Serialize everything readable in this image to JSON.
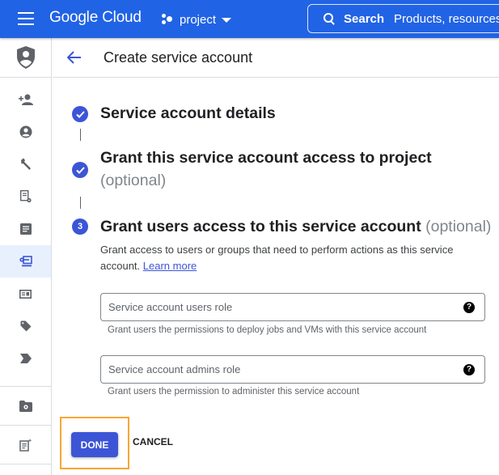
{
  "topbar": {
    "logo": "Google Cloud",
    "project_label": "project",
    "search_label": "Search",
    "search_placeholder": "Products, resources",
    "bg_color": "#2163e5"
  },
  "sidenav": {
    "header_icon": "iam-shield-icon",
    "items": [
      {
        "icon": "person-add-icon",
        "active": false
      },
      {
        "icon": "account-circle-icon",
        "active": false
      },
      {
        "icon": "wrench-icon",
        "active": false
      },
      {
        "icon": "policy-document-icon",
        "active": false
      },
      {
        "icon": "article-icon",
        "active": false
      },
      {
        "icon": "service-account-key-icon",
        "active": true
      },
      {
        "icon": "id-card-icon",
        "active": false
      },
      {
        "icon": "tag-icon",
        "active": false
      },
      {
        "icon": "label-arrow-icon",
        "active": false
      },
      {
        "icon": "partial-icon",
        "active": false
      }
    ],
    "bottom_items": [
      {
        "icon": "folder-settings-icon"
      },
      {
        "icon": "release-notes-icon"
      }
    ]
  },
  "page": {
    "title": "Create service account",
    "accent_color": "#3c55d6"
  },
  "steps": [
    {
      "status": "complete",
      "title": "Service account details",
      "optional": ""
    },
    {
      "status": "complete",
      "title": "Grant this service account access to project",
      "optional": "(optional)"
    },
    {
      "status": "current",
      "number": "3",
      "title": "Grant users access to this service account",
      "optional": "(optional)"
    }
  ],
  "step3": {
    "description": "Grant access to users or groups that need to perform actions as this service account.",
    "learn_more": "Learn more",
    "fields": [
      {
        "label": "Service account users role",
        "value": "",
        "hint": "Grant users the permissions to deploy jobs and VMs with this service account"
      },
      {
        "label": "Service account admins role",
        "value": "",
        "hint": "Grant users the permission to administer this service account"
      }
    ]
  },
  "actions": {
    "done": "DONE",
    "cancel": "CANCEL",
    "highlight_color": "#f9a633"
  }
}
